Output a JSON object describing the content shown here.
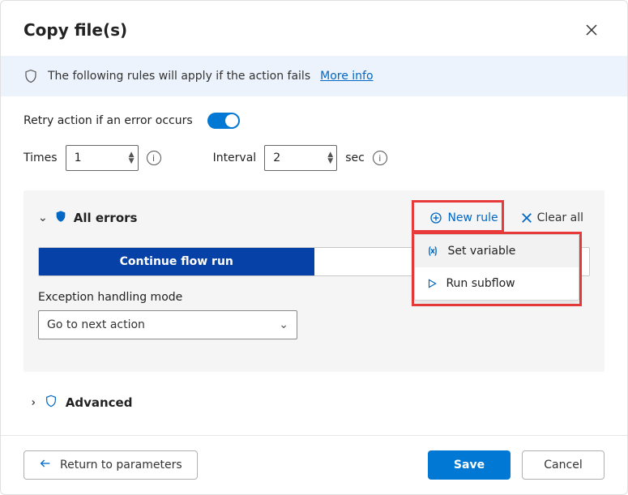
{
  "header": {
    "title": "Copy file(s)"
  },
  "banner": {
    "text": "The following rules will apply if the action fails ",
    "link": "More info"
  },
  "retry": {
    "label": "Retry action if an error occurs",
    "on": true
  },
  "times": {
    "label": "Times",
    "value": "1"
  },
  "interval": {
    "label": "Interval",
    "value": "2",
    "unit": "sec"
  },
  "panel": {
    "title": "All errors",
    "newrule": "New rule",
    "clearall": "Clear all",
    "menu": {
      "setvar": "Set variable",
      "runsub": "Run subflow"
    },
    "seg_active": "Continue flow run",
    "seg_inactive": "",
    "mode_label": "Exception handling mode",
    "mode_value": "Go to next action"
  },
  "advanced": "Advanced",
  "footer": {
    "return": "Return to parameters",
    "save": "Save",
    "cancel": "Cancel"
  }
}
